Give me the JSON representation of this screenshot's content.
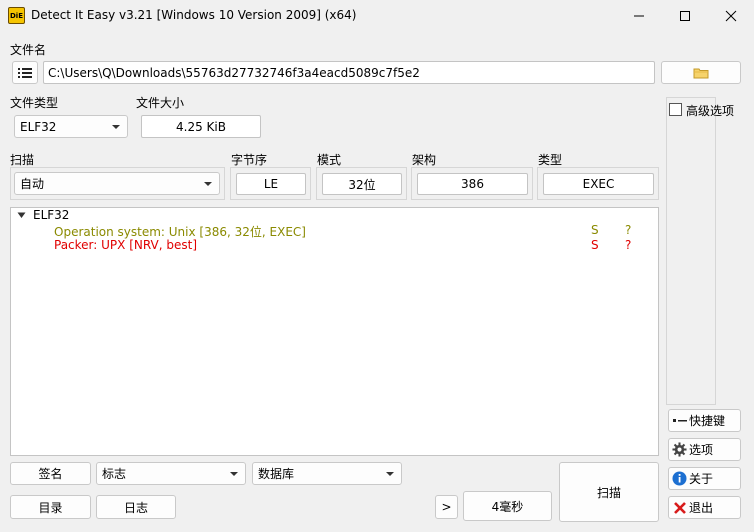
{
  "window": {
    "title": "Detect It Easy v3.21 [Windows 10 Version 2009] (x64)",
    "icon_text": "DiE"
  },
  "file": {
    "label": "文件名",
    "path": "C:\\Users\\Q\\Downloads\\55763d27732746f3a4eacd5089c7f5e2"
  },
  "filetype": {
    "label": "文件类型",
    "value": "ELF32"
  },
  "filesize": {
    "label": "文件大小",
    "value": "4.25 KiB"
  },
  "advanced": {
    "label": "高级选项",
    "checked": false
  },
  "scan_row": {
    "scan_label": "扫描",
    "scan_value": "自动",
    "endian_label": "字节序",
    "endian_value": "LE",
    "mode_label": "模式",
    "mode_value": "32位",
    "arch_label": "架构",
    "arch_value": "386",
    "type_label": "类型",
    "type_value": "EXEC"
  },
  "results": {
    "root": "ELF32",
    "items": [
      {
        "text": "Operation system: Unix [386, 32位, EXEC]",
        "s": "S",
        "q": "?",
        "color": "#8a8a00"
      },
      {
        "text": "Packer: UPX [NRV, best]",
        "s": "S",
        "q": "?",
        "color": "#e00000"
      }
    ]
  },
  "bottom": {
    "signature": "签名",
    "flags": "标志",
    "database": "数据库",
    "directory": "目录",
    "log": "日志",
    "more": ">",
    "time": "4毫秒",
    "scan": "扫描"
  },
  "side": {
    "shortcuts": "快捷键",
    "options": "选项",
    "about": "关于",
    "exit": "退出"
  }
}
